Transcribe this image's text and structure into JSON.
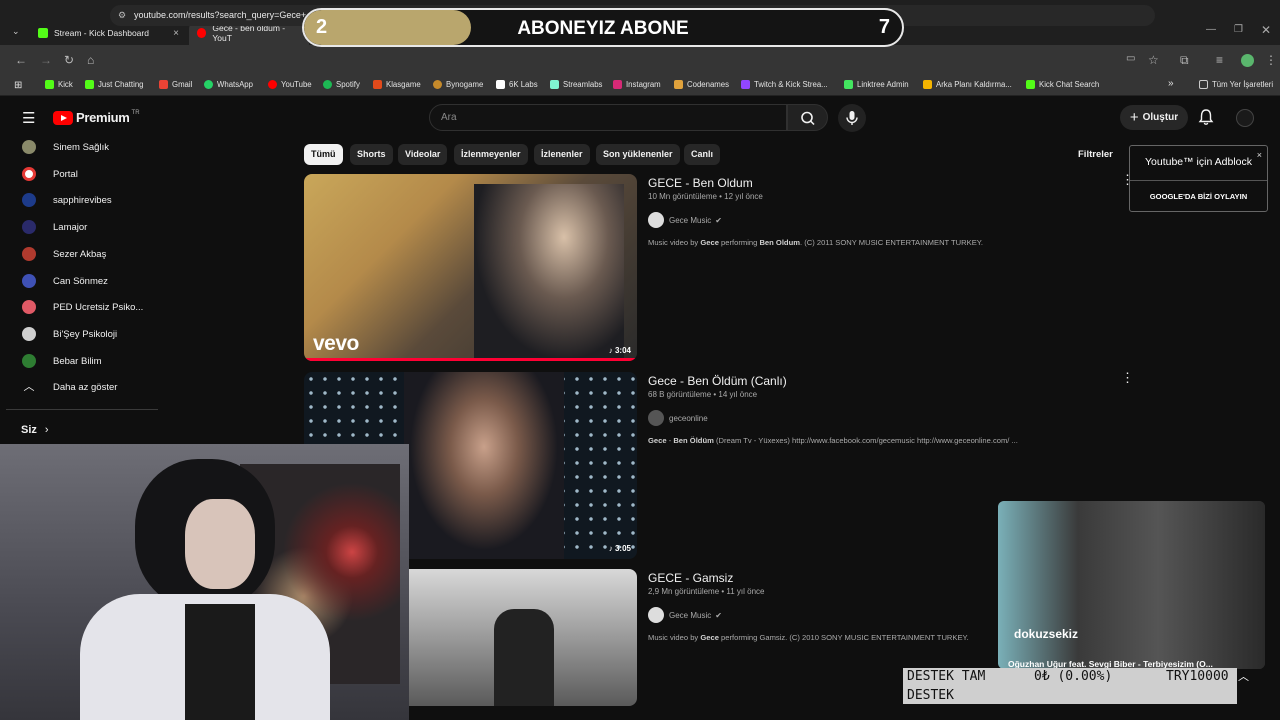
{
  "browser": {
    "tabs": [
      {
        "title": "Stream - Kick Dashboard",
        "favicon_color": "#53fc18",
        "active": false
      },
      {
        "title": "Gece - ben oldum - YouT",
        "favicon_color": "#ff0000",
        "active": true
      }
    ],
    "url": "youtube.com/results?search_query=Gece+-+ben+oldum",
    "bookmarks": [
      {
        "label": "Kick",
        "color": "#53fc18"
      },
      {
        "label": "Just Chatting",
        "color": "#53fc18"
      },
      {
        "label": "Gmail",
        "color": "#ea4335"
      },
      {
        "label": "WhatsApp",
        "color": "#25d366"
      },
      {
        "label": "YouTube",
        "color": "#ff0000"
      },
      {
        "label": "Spotify",
        "color": "#1db954"
      },
      {
        "label": "Klasgame",
        "color": "#e24a1b"
      },
      {
        "label": "Bynogame",
        "color": "#c58a2b"
      },
      {
        "label": "6K Labs",
        "color": "#ffffff"
      },
      {
        "label": "Streamlabs",
        "color": "#80f5d2"
      },
      {
        "label": "Instagram",
        "color": "#d62976"
      },
      {
        "label": "Codenames",
        "color": "#e0a23c"
      },
      {
        "label": "Twitch & Kick Strea...",
        "color": "#9146ff"
      },
      {
        "label": "Linktree Admin",
        "color": "#43e660"
      },
      {
        "label": "Arka Planı Kaldırma...",
        "color": "#f4b400"
      },
      {
        "label": "Kick Chat Search",
        "color": "#53fc18"
      }
    ],
    "all_bookmarks": "Tüm Yer İşaretleri",
    "more": "»"
  },
  "overlay": {
    "goal_start": "2",
    "goal_title": "ABONEYIZ ABONE",
    "goal_end": "7",
    "goal_progress": 0.28
  },
  "youtube": {
    "logo_text": "Premium",
    "country": "TR",
    "search_placeholder": "Ara",
    "create_label": "Oluştur",
    "sidebar": {
      "subscriptions": [
        {
          "name": "Sinem Sağlık",
          "color": "#8a8a6a"
        },
        {
          "name": "Portal",
          "color": "#e53935"
        },
        {
          "name": "sapphirevibes",
          "color": "#1d3b8a"
        },
        {
          "name": "Lamajor",
          "color": "#2a2a6a"
        },
        {
          "name": "Sezer Akbaş",
          "color": "#b03a2e"
        },
        {
          "name": "Can Sönmez",
          "color": "#3f51b5"
        },
        {
          "name": "PED Ucretsiz Psiko...",
          "color": "#e05a66"
        },
        {
          "name": "Bi'Şey Psikoloji",
          "color": "#cfcfcf"
        },
        {
          "name": "Bebar Bilim",
          "color": "#2e7d32"
        }
      ],
      "show_less": "Daha az göster",
      "you_label": "Siz"
    },
    "chips": [
      "Tümü",
      "Shorts",
      "Videolar",
      "İzlenmeyenler",
      "İzlenenler",
      "Son yüklenenler",
      "Canlı"
    ],
    "filters_label": "Filtreler",
    "results": [
      {
        "title": "GECE - Ben Oldum",
        "meta": "10 Mn görüntüleme • 12 yıl önce",
        "channel": "Gece Music",
        "verified": true,
        "desc_parts": [
          "Music video by ",
          "Gece",
          " performing ",
          "Ben Oldum",
          ". (C) 2011 SONY MUSIC ENTERTAINMENT TURKEY."
        ],
        "duration": "3:04",
        "thumb_brand": "vevo"
      },
      {
        "title": "Gece - Ben Öldüm (Canlı)",
        "meta": "68 B görüntüleme • 14 yıl önce",
        "channel": "geceonline",
        "verified": false,
        "desc_parts": [
          "Gece",
          " - ",
          "Ben Öldüm",
          " (Dream Tv - Yüxexes) http://www.facebook.com/gecemusic http://www.geceonline.com/ ..."
        ],
        "duration": "3:05",
        "thumb_brand": ""
      },
      {
        "title": "GECE - Gamsiz",
        "meta": "2,9 Mn görüntüleme • 11 yıl önce",
        "channel": "Gece Music",
        "verified": true,
        "desc_parts": [
          "Music video by ",
          "Gece",
          " performing Gamsiz. (C) 2010 SONY MUSIC ENTERTAINMENT TURKEY."
        ],
        "duration": "",
        "thumb_brand": ""
      }
    ]
  },
  "adblock_popup": {
    "title": "Youtube™ için Adblock",
    "vote_label": "GOOGLE'DA BİZİ OYLAYIN",
    "close": "×"
  },
  "now_playing": {
    "caption": "Oğuzhan Uğur feat. Sevgi Biber - Terbiyesizim (O...",
    "brand": "dokuzsekiz"
  },
  "donation": {
    "label_line1": "DESTEK TAM",
    "label_line2": "DESTEK",
    "amount": "0₺ (0.00%)",
    "target": "TRY10000"
  },
  "colors": {
    "yt_red": "#ff0000",
    "goal_fill": "#b9a66d",
    "background": "#0f0f0f"
  }
}
